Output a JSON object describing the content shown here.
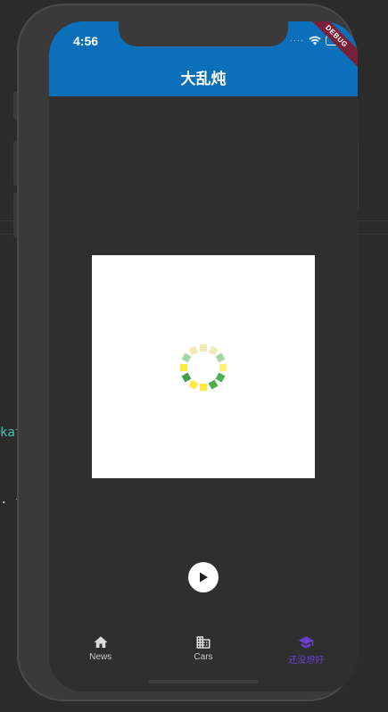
{
  "status_bar": {
    "time": "4:56",
    "debug_label": "DEBUG"
  },
  "app_bar": {
    "title": "大乱炖"
  },
  "background_code": {
    "fragment_a": "kat",
    "fragment_b": ". {"
  },
  "spinner": {
    "colors": [
      "#f3e9b5",
      "#f3e9b5",
      "#a5d7a7",
      "#fff176",
      "#4caf50",
      "#4caf50",
      "#ffeb3b",
      "#ffeb3b",
      "#43a047",
      "#ffeb3b",
      "#a5d7a7",
      "#f3e9b5"
    ]
  },
  "bottom_nav": {
    "items": [
      {
        "label": "News",
        "icon": "home-icon",
        "active": false
      },
      {
        "label": "Cars",
        "icon": "building-icon",
        "active": false
      },
      {
        "label": "还没想好",
        "icon": "school-icon",
        "active": true
      }
    ]
  },
  "colors": {
    "app_bar": "#0b6fba",
    "active_nav": "#6a3fcf",
    "inactive_nav": "#c8c8c8",
    "screen_bg": "#2f2f2f"
  }
}
